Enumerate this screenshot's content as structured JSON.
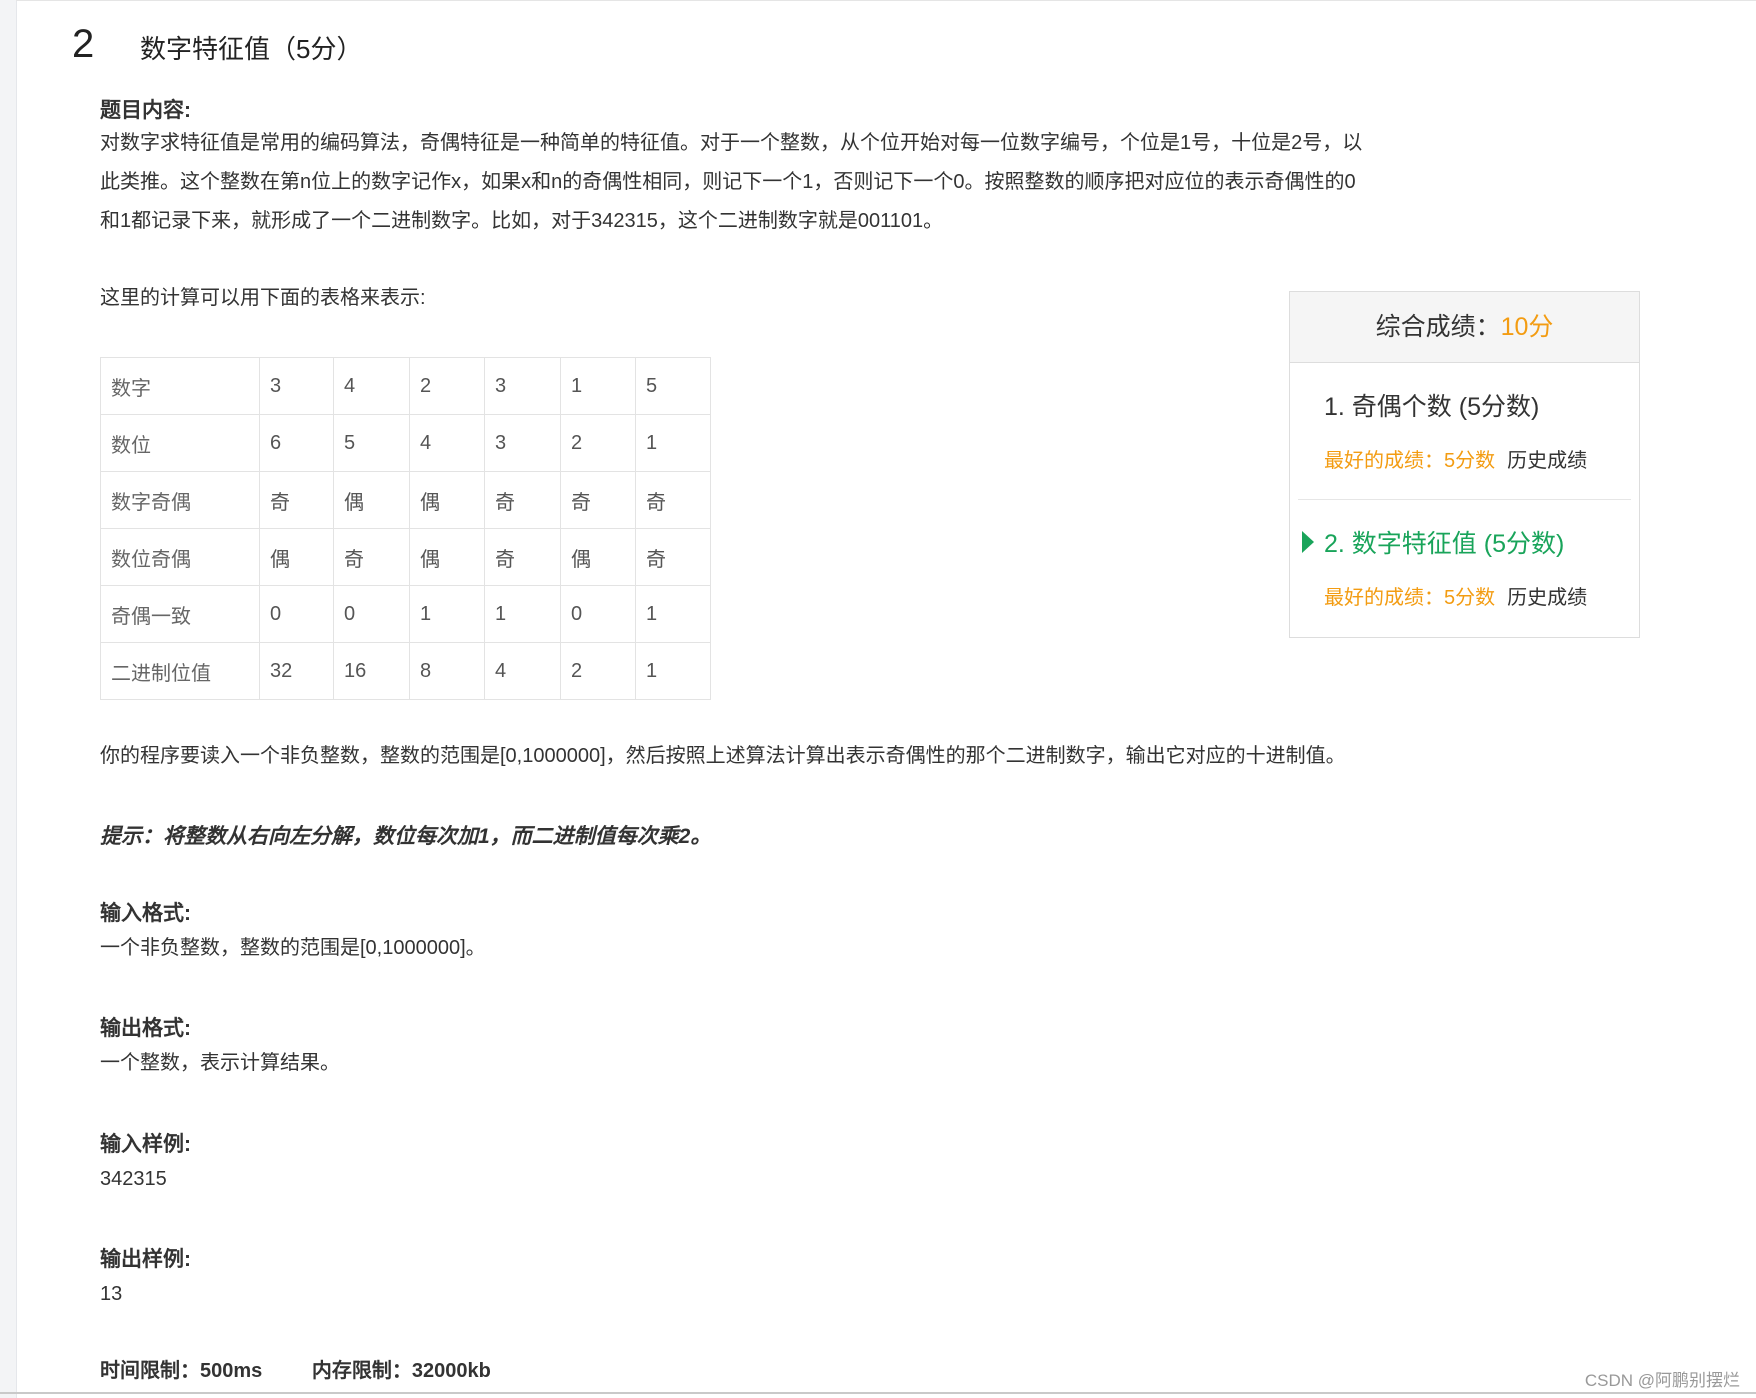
{
  "problem": {
    "number": "2",
    "title": "数字特征值（5分）"
  },
  "content": {
    "heading": "题目内容:",
    "paragraph_lines": [
      "对数字求特征值是常用的编码算法，奇偶特征是一种简单的特征值。对于一个整数，从个位开始对每一位数字编号，个位是1号，十位是2号，以",
      "此类推。这个整数在第n位上的数字记作x，如果x和n的奇偶性相同，则记下一个1，否则记下一个0。按照整数的顺序把对应位的表示奇偶性的0",
      "和1都记录下来，就形成了一个二进制数字。比如，对于342315，这个二进制数字就是001101。"
    ],
    "table_intro": "这里的计算可以用下面的表格来表示:",
    "table": [
      {
        "label": "数字",
        "cells": [
          "3",
          "4",
          "2",
          "3",
          "1",
          "5"
        ]
      },
      {
        "label": "数位",
        "cells": [
          "6",
          "5",
          "4",
          "3",
          "2",
          "1"
        ]
      },
      {
        "label": "数字奇偶",
        "cells": [
          "奇",
          "偶",
          "偶",
          "奇",
          "奇",
          "奇"
        ]
      },
      {
        "label": "数位奇偶",
        "cells": [
          "偶",
          "奇",
          "偶",
          "奇",
          "偶",
          "奇"
        ]
      },
      {
        "label": "奇偶一致",
        "cells": [
          "0",
          "0",
          "1",
          "1",
          "0",
          "1"
        ]
      },
      {
        "label": "二进制位值",
        "cells": [
          "32",
          "16",
          "8",
          "4",
          "2",
          "1"
        ]
      }
    ],
    "program_desc": "你的程序要读入一个非负整数，整数的范围是[0,1000000]，然后按照上述算法计算出表示奇偶性的那个二进制数字，输出它对应的十进制值。",
    "hint": "提示：将整数从右向左分解，数位每次加1，而二进制值每次乘2。"
  },
  "input_format": {
    "heading": "输入格式:",
    "text": "一个非负整数，整数的范围是[0,1000000]。"
  },
  "output_format": {
    "heading": "输出格式:",
    "text": "一个整数，表示计算结果。"
  },
  "input_sample": {
    "heading": "输入样例:",
    "text": "342315"
  },
  "output_sample": {
    "heading": "输出样例:",
    "text": "13"
  },
  "limits": {
    "time": "时间限制：500ms",
    "memory": "内存限制：32000kb"
  },
  "score_panel": {
    "label": "综合成绩：",
    "total": "10分",
    "items": [
      {
        "title": "1. 奇偶个数 (5分数)",
        "best": "最好的成绩：5分数",
        "history": "历史成绩",
        "active": false
      },
      {
        "title": "2. 数字特征值 (5分数)",
        "best": "最好的成绩：5分数",
        "history": "历史成绩",
        "active": true
      }
    ]
  },
  "watermark": "CSDN @阿鹏别摆烂",
  "colors": {
    "accent_orange": "#f39c12",
    "active_green": "#19a45a"
  }
}
